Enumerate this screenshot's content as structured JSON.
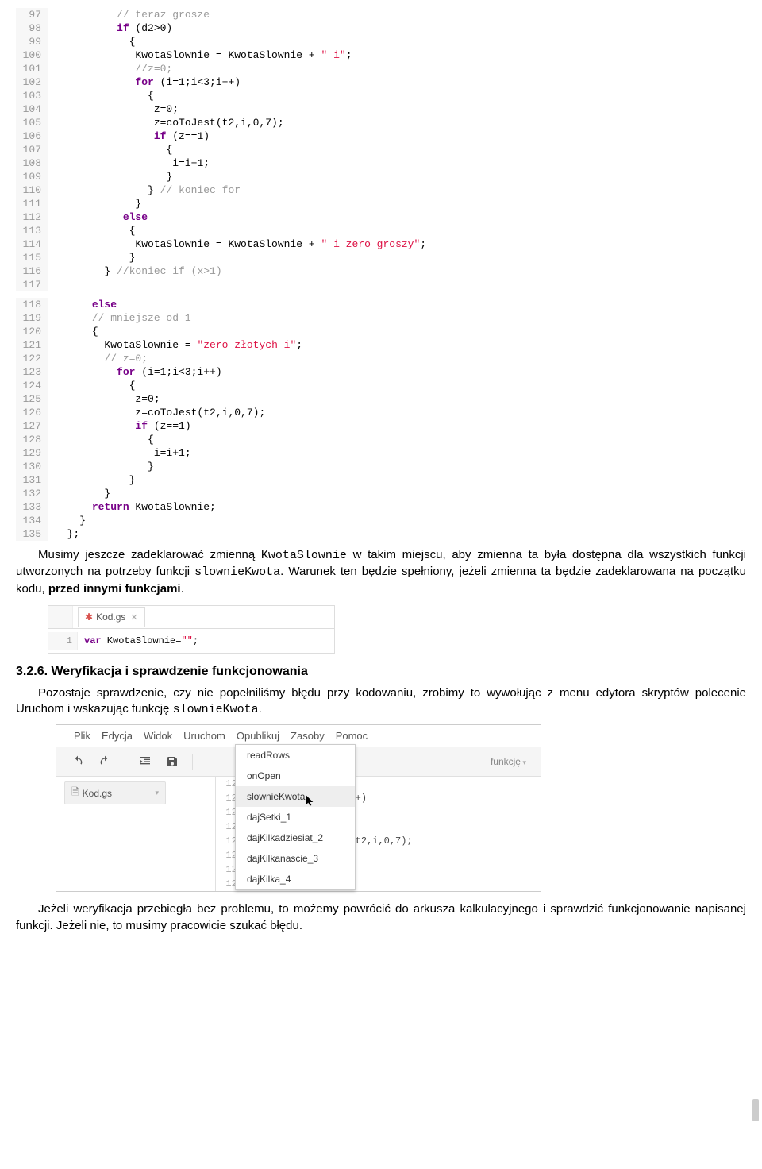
{
  "code1": {
    "start": 97,
    "lines": [
      {
        "raw": "          ",
        "seg": [
          {
            "t": "// teraz grosze",
            "c": "cm-comment"
          }
        ]
      },
      {
        "raw": "          ",
        "seg": [
          {
            "t": "if",
            "c": "cm-keyword"
          },
          {
            "t": " (d2>0)",
            "c": ""
          }
        ]
      },
      {
        "raw": "            ",
        "seg": [
          {
            "t": "{",
            "c": ""
          }
        ]
      },
      {
        "raw": "             ",
        "seg": [
          {
            "t": "KwotaSlownie = KwotaSlownie + ",
            "c": ""
          },
          {
            "t": "\" i\"",
            "c": "cm-string"
          },
          {
            "t": ";",
            "c": ""
          }
        ]
      },
      {
        "raw": "             ",
        "seg": [
          {
            "t": "//z=0;",
            "c": "cm-comment"
          }
        ]
      },
      {
        "raw": "             ",
        "seg": [
          {
            "t": "for",
            "c": "cm-keyword"
          },
          {
            "t": " (i=1;i<3;i++)",
            "c": ""
          }
        ]
      },
      {
        "raw": "               ",
        "seg": [
          {
            "t": "{",
            "c": ""
          }
        ]
      },
      {
        "raw": "                ",
        "seg": [
          {
            "t": "z=0;",
            "c": ""
          }
        ]
      },
      {
        "raw": "                ",
        "seg": [
          {
            "t": "z=coToJest(t2,i,0,7);",
            "c": ""
          }
        ]
      },
      {
        "raw": "                ",
        "seg": [
          {
            "t": "if",
            "c": "cm-keyword"
          },
          {
            "t": " (z==1)",
            "c": ""
          }
        ]
      },
      {
        "raw": "                  ",
        "seg": [
          {
            "t": "{",
            "c": ""
          }
        ]
      },
      {
        "raw": "                   ",
        "seg": [
          {
            "t": "i=i+1;",
            "c": ""
          }
        ]
      },
      {
        "raw": "                  ",
        "seg": [
          {
            "t": "}",
            "c": ""
          }
        ]
      },
      {
        "raw": "               ",
        "seg": [
          {
            "t": "} ",
            "c": ""
          },
          {
            "t": "// koniec for",
            "c": "cm-comment"
          }
        ]
      },
      {
        "raw": "             ",
        "seg": [
          {
            "t": "}",
            "c": ""
          }
        ]
      },
      {
        "raw": "           ",
        "seg": [
          {
            "t": "else",
            "c": "cm-keyword"
          }
        ]
      },
      {
        "raw": "            ",
        "seg": [
          {
            "t": "{",
            "c": ""
          }
        ]
      },
      {
        "raw": "             ",
        "seg": [
          {
            "t": "KwotaSlownie = KwotaSlownie + ",
            "c": ""
          },
          {
            "t": "\" i zero groszy\"",
            "c": "cm-string"
          },
          {
            "t": ";",
            "c": ""
          }
        ]
      },
      {
        "raw": "            ",
        "seg": [
          {
            "t": "}",
            "c": ""
          }
        ]
      },
      {
        "raw": "        ",
        "seg": [
          {
            "t": "} ",
            "c": ""
          },
          {
            "t": "//koniec if (x>1)",
            "c": "cm-comment"
          }
        ]
      },
      {
        "raw": "",
        "seg": [
          {
            "t": "",
            "c": ""
          }
        ]
      }
    ]
  },
  "code2": {
    "start": 118,
    "lines": [
      {
        "raw": "      ",
        "seg": [
          {
            "t": "else",
            "c": "cm-keyword"
          }
        ]
      },
      {
        "raw": "      ",
        "seg": [
          {
            "t": "// mniejsze od 1",
            "c": "cm-comment"
          }
        ]
      },
      {
        "raw": "      ",
        "seg": [
          {
            "t": "{",
            "c": ""
          }
        ]
      },
      {
        "raw": "        ",
        "seg": [
          {
            "t": "KwotaSlownie = ",
            "c": ""
          },
          {
            "t": "\"zero złotych i\"",
            "c": "cm-string"
          },
          {
            "t": ";",
            "c": ""
          }
        ]
      },
      {
        "raw": "        ",
        "seg": [
          {
            "t": "// z=0;",
            "c": "cm-comment"
          }
        ]
      },
      {
        "raw": "          ",
        "seg": [
          {
            "t": "for",
            "c": "cm-keyword"
          },
          {
            "t": " (i=1;i<3;i++)",
            "c": ""
          }
        ]
      },
      {
        "raw": "            ",
        "seg": [
          {
            "t": "{",
            "c": ""
          }
        ]
      },
      {
        "raw": "             ",
        "seg": [
          {
            "t": "z=0;",
            "c": ""
          }
        ]
      },
      {
        "raw": "             ",
        "seg": [
          {
            "t": "z=coToJest(t2,i,0,7);",
            "c": ""
          }
        ]
      },
      {
        "raw": "             ",
        "seg": [
          {
            "t": "if",
            "c": "cm-keyword"
          },
          {
            "t": " (z==1)",
            "c": ""
          }
        ]
      },
      {
        "raw": "               ",
        "seg": [
          {
            "t": "{",
            "c": ""
          }
        ]
      },
      {
        "raw": "                ",
        "seg": [
          {
            "t": "i=i+1;",
            "c": ""
          }
        ]
      },
      {
        "raw": "               ",
        "seg": [
          {
            "t": "}",
            "c": ""
          }
        ]
      },
      {
        "raw": "            ",
        "seg": [
          {
            "t": "}",
            "c": ""
          }
        ]
      },
      {
        "raw": "        ",
        "seg": [
          {
            "t": "}",
            "c": ""
          }
        ]
      },
      {
        "raw": "      ",
        "seg": [
          {
            "t": "return",
            "c": "cm-keyword"
          },
          {
            "t": " KwotaSlownie;",
            "c": ""
          }
        ]
      },
      {
        "raw": "    ",
        "seg": [
          {
            "t": "}",
            "c": ""
          }
        ]
      },
      {
        "raw": "  ",
        "seg": [
          {
            "t": "};",
            "c": ""
          }
        ]
      }
    ]
  },
  "para1_a": "Musimy jeszcze zadeklarować zmienną ",
  "para1_code1": "KwotaSlownie",
  "para1_b": " w takim miejscu, aby zmienna ta była dostępna dla wszystkich funkcji utworzonych na potrzeby funkcji ",
  "para1_code2": "slownieKwota",
  "para1_c": ". Warunek ten będzie spełniony, jeżeli zmienna ta będzie zadeklarowana na początku kodu, ",
  "para1_bold": "przed innymi funkcjami",
  "para1_d": ".",
  "mini": {
    "tab_name": "Kod.gs",
    "line_no": "1",
    "code_kw": "var",
    "code_rest": " KwotaSlownie=",
    "code_str": "\"\"",
    "code_semi": ";"
  },
  "section_heading": "3.2.6. Weryfikacja i sprawdzenie funkcjonowania",
  "para2_a": "Pozostaje sprawdzenie, czy nie popełniliśmy błędu przy kodowaniu, zrobimy to wywołując z menu edytora skryptów polecenie Uruchom i wskazując funkcję ",
  "para2_code": "slownieKwota",
  "para2_b": ".",
  "apps": {
    "menu": [
      "Plik",
      "Edycja",
      "Widok",
      "Uruchom",
      "Opublikuj",
      "Zasoby",
      "Pomoc"
    ],
    "toolbar_text": "funkcję",
    "file_name": "Kod.gs",
    "dropdown": [
      "readRows",
      "onOpen",
      "slownieKwota",
      "dajSetki_1",
      "dajKilkadziesiat_2",
      "dajKilkanascie_3",
      "dajKilka_4"
    ],
    "dropdown_hover_index": 2,
    "code": [
      {
        "n": "122",
        "t": ""
      },
      {
        "n": "123",
        "t": "                 ++)"
      },
      {
        "n": "124",
        "t": ""
      },
      {
        "n": "125",
        "t": ""
      },
      {
        "n": "126",
        "t": "                 (t2,i,0,7);"
      },
      {
        "n": "127",
        "t": ""
      },
      {
        "n": "128",
        "t": ""
      },
      {
        "n": "129",
        "t": ""
      }
    ]
  },
  "para3": "Jeżeli weryfikacja przebiegła bez problemu, to możemy powrócić do arkusza kalkulacyjnego i sprawdzić funkcjonowanie napisanej funkcji. Jeżeli nie, to musimy pracowicie szukać błędu."
}
